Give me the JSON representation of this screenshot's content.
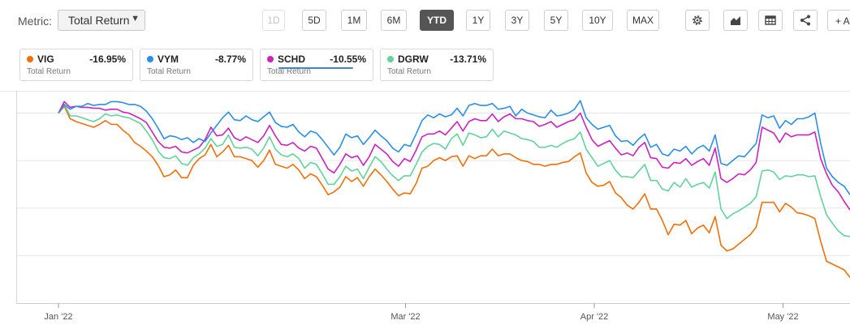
{
  "toolbar": {
    "metric_label": "Metric:",
    "metric_value": "Total Return",
    "ranges": [
      {
        "label": "1D",
        "state": "disabled"
      },
      {
        "label": "5D",
        "state": "normal"
      },
      {
        "label": "1M",
        "state": "normal"
      },
      {
        "label": "6M",
        "state": "normal"
      },
      {
        "label": "YTD",
        "state": "active"
      },
      {
        "label": "1Y",
        "state": "normal"
      },
      {
        "label": "3Y",
        "state": "normal"
      },
      {
        "label": "5Y",
        "state": "normal"
      },
      {
        "label": "10Y",
        "state": "normal"
      },
      {
        "label": "MAX",
        "state": "normal"
      }
    ],
    "icons": [
      "gear-icon",
      "chart-type-icon",
      "table-icon",
      "share-icon"
    ],
    "add_label": "+ Ad"
  },
  "legend_cards": [
    {
      "ticker": "VIG",
      "value": "-16.95%",
      "sub": "Total Return",
      "color": "#f26f0a"
    },
    {
      "ticker": "VYM",
      "value": "-8.77%",
      "sub": "Total Return",
      "color": "#2a8fe6"
    },
    {
      "ticker": "SCHD",
      "value": "-10.55%",
      "sub": "Total Return",
      "color": "#cc22bf",
      "underline": true
    },
    {
      "ticker": "DGRW",
      "value": "-13.71%",
      "sub": "Total Return",
      "color": "#62d39a"
    }
  ],
  "chart_data": {
    "type": "line",
    "x_start": "2022-01-03",
    "x_end": "2022-05-13",
    "x_ticks": [
      {
        "label": "Jan '22",
        "date": "2022-01-03"
      },
      {
        "label": "Mar '22",
        "date": "2022-03-01"
      },
      {
        "label": "Apr '22",
        "date": "2022-04-01"
      },
      {
        "label": "May '22",
        "date": "2022-05-02"
      }
    ],
    "ylim": [
      -20,
      2
    ],
    "gridlines": [
      0,
      -5,
      -10,
      -15
    ],
    "grid": true,
    "series": [
      {
        "name": "VYM",
        "color": "#2a8fe6",
        "values": [
          0.0,
          0.9,
          0.4,
          0.7,
          0.7,
          1.0,
          0.8,
          0.9,
          0.9,
          1.2,
          1.2,
          1.1,
          0.9,
          0.9,
          0.7,
          0.2,
          -0.6,
          -1.6,
          -2.7,
          -2.4,
          -2.5,
          -2.8,
          -2.6,
          -3.1,
          -2.7,
          -3.0,
          -2.1,
          -1.3,
          -0.5,
          0.1,
          -0.7,
          -0.8,
          -0.3,
          -0.7,
          -0.9,
          -0.4,
          0.1,
          -1.0,
          -1.4,
          -1.5,
          -1.2,
          -2.0,
          -2.5,
          -1.9,
          -2.1,
          -2.8,
          -3.6,
          -4.4,
          -3.6,
          -2.2,
          -2.6,
          -2.4,
          -3.3,
          -2.6,
          -1.8,
          -2.4,
          -2.9,
          -3.7,
          -4.1,
          -3.3,
          -3.5,
          -2.2,
          -0.8,
          -0.2,
          -0.5,
          -0.1,
          -0.4,
          -0.2,
          0.5,
          -0.3,
          0.8,
          1.0,
          0.8,
          0.8,
          1.0,
          0.4,
          0.5,
          0.7,
          -0.3,
          0.4,
          0.0,
          -0.2,
          -0.4,
          -0.5,
          0.3,
          -0.3,
          -0.2,
          0.0,
          0.4,
          1.3,
          -0.5,
          -1.2,
          -1.7,
          -1.5,
          -1.3,
          -2.4,
          -3.0,
          -2.9,
          -3.4,
          -2.7,
          -2.2,
          -3.6,
          -3.3,
          -4.3,
          -4.5,
          -3.8,
          -4.0,
          -3.5,
          -4.3,
          -3.7,
          -3.4,
          -4.0,
          -2.3,
          -5.3,
          -5.5,
          -5.0,
          -4.5,
          -4.6,
          -3.9,
          -3.2,
          -0.2,
          -0.5,
          -0.3,
          -1.6,
          -0.8,
          -1.2,
          -0.6,
          -0.6,
          -0.4,
          0.0,
          -3.2,
          -5.8,
          -6.7,
          -7.3,
          -7.7,
          -8.6
        ]
      },
      {
        "name": "SCHD",
        "color": "#cc22bf",
        "values": [
          0.0,
          1.2,
          0.6,
          0.7,
          0.6,
          0.6,
          0.5,
          0.5,
          0.3,
          0.4,
          0.4,
          0.1,
          0.0,
          -0.3,
          -0.6,
          -1.0,
          -2.0,
          -3.0,
          -3.6,
          -3.7,
          -3.5,
          -4.1,
          -4.2,
          -3.9,
          -3.6,
          -2.8,
          -1.5,
          -2.4,
          -2.3,
          -1.6,
          -2.6,
          -2.9,
          -2.5,
          -2.8,
          -3.1,
          -2.4,
          -1.3,
          -2.4,
          -3.3,
          -3.4,
          -3.1,
          -3.7,
          -4.0,
          -3.5,
          -3.7,
          -4.8,
          -5.9,
          -6.3,
          -5.4,
          -4.3,
          -4.7,
          -4.5,
          -5.5,
          -4.6,
          -3.3,
          -3.8,
          -4.3,
          -5.1,
          -5.6,
          -4.8,
          -5.1,
          -3.9,
          -2.5,
          -2.2,
          -2.2,
          -1.9,
          -2.3,
          -1.6,
          -0.9,
          -1.9,
          -0.9,
          -0.6,
          -0.8,
          -0.8,
          -0.1,
          -0.9,
          -0.4,
          -0.1,
          -0.6,
          -0.6,
          -0.8,
          -0.9,
          -1.4,
          -1.2,
          -0.9,
          -1.5,
          -1.2,
          -0.9,
          -0.7,
          0.0,
          -1.5,
          -2.8,
          -3.5,
          -3.2,
          -2.9,
          -3.7,
          -4.4,
          -4.2,
          -4.5,
          -3.6,
          -3.1,
          -4.7,
          -4.8,
          -5.7,
          -5.8,
          -5.2,
          -5.3,
          -4.8,
          -5.5,
          -5.1,
          -4.8,
          -5.5,
          -3.7,
          -6.9,
          -7.3,
          -6.9,
          -6.4,
          -6.5,
          -6.0,
          -5.2,
          -1.5,
          -1.8,
          -2.1,
          -3.1,
          -2.1,
          -2.5,
          -2.3,
          -2.3,
          -2.3,
          -2.0,
          -4.8,
          -6.4,
          -7.6,
          -8.3,
          -9.3,
          -10.2
        ]
      },
      {
        "name": "DGRW",
        "color": "#62d39a",
        "values": [
          0.0,
          0.9,
          -0.3,
          -0.3,
          -0.5,
          -0.7,
          -0.9,
          -0.6,
          -0.1,
          -0.3,
          -0.2,
          -0.4,
          -0.5,
          -0.8,
          -1.1,
          -1.9,
          -2.8,
          -4.0,
          -4.7,
          -4.8,
          -4.5,
          -5.3,
          -5.5,
          -4.7,
          -4.3,
          -3.7,
          -2.7,
          -3.5,
          -3.3,
          -2.3,
          -3.6,
          -3.7,
          -3.6,
          -3.8,
          -4.5,
          -3.7,
          -2.5,
          -3.8,
          -4.4,
          -4.6,
          -4.3,
          -4.8,
          -5.8,
          -5.2,
          -5.4,
          -6.4,
          -7.5,
          -7.5,
          -6.7,
          -5.6,
          -6.1,
          -5.9,
          -6.9,
          -5.7,
          -4.6,
          -5.1,
          -5.9,
          -6.6,
          -7.1,
          -6.6,
          -6.6,
          -5.4,
          -4.1,
          -3.5,
          -3.2,
          -3.3,
          -3.8,
          -2.7,
          -2.2,
          -3.4,
          -2.1,
          -2.3,
          -2.6,
          -2.5,
          -1.7,
          -2.5,
          -1.9,
          -2.1,
          -2.3,
          -2.7,
          -2.8,
          -3.0,
          -3.6,
          -3.6,
          -3.4,
          -3.6,
          -3.2,
          -2.9,
          -2.7,
          -2.0,
          -3.8,
          -4.7,
          -5.6,
          -5.3,
          -5.0,
          -6.0,
          -6.7,
          -6.7,
          -6.8,
          -6.1,
          -5.4,
          -7.1,
          -7.1,
          -8.0,
          -8.2,
          -7.3,
          -7.8,
          -6.9,
          -7.8,
          -7.5,
          -7.3,
          -7.9,
          -6.2,
          -10.1,
          -11.1,
          -10.6,
          -10.3,
          -9.9,
          -9.5,
          -8.8,
          -6.1,
          -6.0,
          -6.2,
          -7.0,
          -6.6,
          -6.7,
          -6.5,
          -6.5,
          -6.7,
          -6.6,
          -8.8,
          -10.7,
          -11.6,
          -12.4,
          -12.9,
          -13.0
        ]
      },
      {
        "name": "VIG",
        "color": "#f26f0a",
        "values": [
          0.0,
          0.7,
          -0.6,
          -0.9,
          -1.1,
          -1.3,
          -1.5,
          -1.2,
          -0.8,
          -1.2,
          -1.2,
          -1.8,
          -2.3,
          -3.1,
          -3.5,
          -4.0,
          -4.6,
          -5.5,
          -6.7,
          -6.5,
          -6.0,
          -6.8,
          -6.8,
          -5.5,
          -4.8,
          -4.4,
          -3.3,
          -4.6,
          -4.1,
          -3.4,
          -4.6,
          -4.6,
          -4.8,
          -5.0,
          -5.7,
          -5.0,
          -3.9,
          -5.4,
          -5.6,
          -5.8,
          -5.4,
          -6.0,
          -6.9,
          -6.4,
          -6.7,
          -7.6,
          -8.6,
          -8.3,
          -7.8,
          -6.7,
          -7.2,
          -6.8,
          -7.7,
          -6.7,
          -5.9,
          -6.5,
          -7.2,
          -8.0,
          -8.7,
          -8.4,
          -8.5,
          -7.4,
          -5.8,
          -5.6,
          -5.0,
          -4.7,
          -5.0,
          -4.6,
          -4.5,
          -5.6,
          -4.5,
          -4.8,
          -4.5,
          -4.5,
          -3.8,
          -4.5,
          -4.3,
          -4.3,
          -4.7,
          -5.0,
          -5.1,
          -5.4,
          -5.4,
          -5.6,
          -5.4,
          -5.4,
          -5.2,
          -5.1,
          -4.6,
          -4.2,
          -6.3,
          -7.3,
          -7.7,
          -7.6,
          -7.2,
          -8.4,
          -8.9,
          -9.7,
          -10.1,
          -9.4,
          -8.5,
          -10.1,
          -10.1,
          -11.3,
          -12.8,
          -11.7,
          -11.8,
          -11.3,
          -12.7,
          -12.1,
          -11.8,
          -12.6,
          -10.9,
          -13.9,
          -14.5,
          -14.3,
          -13.8,
          -13.3,
          -12.8,
          -12.0,
          -9.4,
          -9.4,
          -9.4,
          -10.4,
          -9.5,
          -9.9,
          -10.5,
          -10.6,
          -10.8,
          -11.1,
          -13.5,
          -15.6,
          -15.9,
          -16.2,
          -16.5,
          -17.3
        ]
      }
    ]
  }
}
